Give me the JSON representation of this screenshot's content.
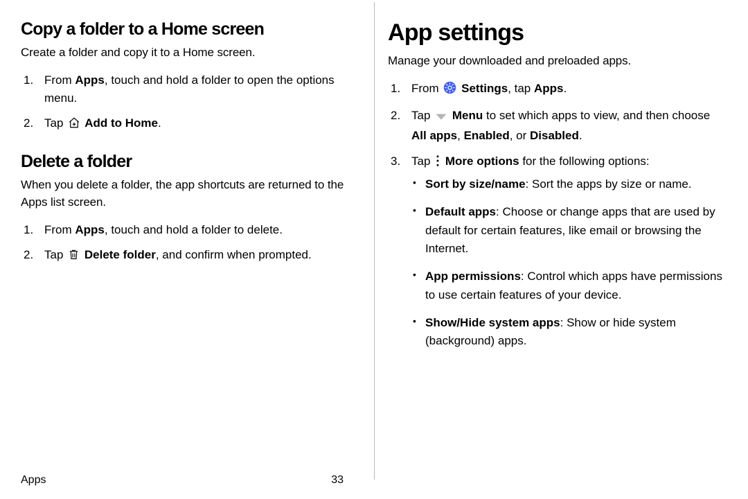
{
  "left": {
    "heading_copy": "Copy a folder to a Home screen",
    "intro_copy": "Create a folder and copy it to a Home screen.",
    "copy_steps": {
      "n1": "1.",
      "s1a": "From ",
      "s1b": "Apps",
      "s1c": ", touch and hold a folder to open the options menu.",
      "n2": "2.",
      "s2a": "Tap ",
      "s2b": " Add to Home",
      "s2c": "."
    },
    "heading_delete": "Delete a folder",
    "intro_delete": "When you delete a folder, the app shortcuts are returned to the Apps list screen.",
    "del_steps": {
      "n1": "1.",
      "s1a": "From ",
      "s1b": "Apps",
      "s1c": ", touch and hold a folder to delete.",
      "n2": "2.",
      "s2a": "Tap ",
      "s2b": " Delete folder",
      "s2c": ", and confirm when prompted."
    }
  },
  "right": {
    "heading": "App settings",
    "intro": "Manage your downloaded and preloaded apps.",
    "steps": {
      "n1": "1.",
      "s1a": "From ",
      "s1b": " Settings",
      "s1c": ", tap ",
      "s1d": "Apps",
      "s1e": ".",
      "n2": "2.",
      "s2a": "Tap ",
      "s2b": " Menu",
      "s2c": " to set which apps to view, and then choose ",
      "s2d": "All apps",
      "s2e": ", ",
      "s2f": "Enabled",
      "s2g": ", or ",
      "s2h": "Disabled",
      "s2i": ".",
      "n3": "3.",
      "s3a": "Tap ",
      "s3b": " More options",
      "s3c": " for the following options:"
    },
    "bullets": {
      "b1a": "Sort by size/name",
      "b1b": ": Sort the apps by size or name.",
      "b2a": "Default apps",
      "b2b": ": Choose or change apps that are used by default for certain features, like email or browsing the Internet.",
      "b3a": "App permissions",
      "b3b": ": Control which apps have permissions to use certain features of your device.",
      "b4a": "Show/Hide system apps",
      "b4b": ": Show or hide system (background) apps."
    }
  },
  "footer": {
    "section": "Apps",
    "page": "33"
  }
}
